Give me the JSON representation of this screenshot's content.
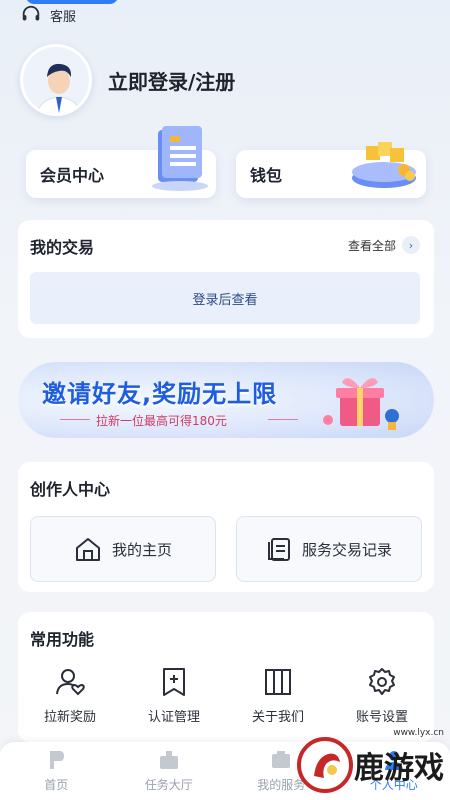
{
  "topbar": {
    "service_label": "客服"
  },
  "profile": {
    "login_text": "立即登录/注册"
  },
  "cards": {
    "member_label": "会员中心",
    "wallet_label": "钱包"
  },
  "trade": {
    "title": "我的交易",
    "view_all": "查看全部",
    "placeholder": "登录后查看"
  },
  "banner": {
    "title": "邀请好友,奖励无上限",
    "subtitle": "拉新一位最高可得180元"
  },
  "creator": {
    "title": "创作人中心",
    "home_label": "我的主页",
    "records_label": "服务交易记录"
  },
  "common": {
    "title": "常用功能",
    "items": [
      {
        "label": "拉新奖励",
        "icon": "user-heart-icon"
      },
      {
        "label": "认证管理",
        "icon": "bookmark-plus-icon"
      },
      {
        "label": "关于我们",
        "icon": "panels-icon"
      },
      {
        "label": "账号设置",
        "icon": "gear-icon"
      }
    ]
  },
  "tabbar": {
    "items": [
      {
        "label": "首页",
        "icon": "home-logo-icon"
      },
      {
        "label": "任务大厅",
        "icon": "task-hall-icon"
      },
      {
        "label": "我的服务",
        "icon": "my-service-icon"
      },
      {
        "label": "个人中心",
        "icon": "profile-icon"
      }
    ]
  },
  "watermark": {
    "text": "鹿游戏",
    "url": "www.lyx.cn"
  },
  "colors": {
    "accent": "#2f7df6",
    "banner_title": "#1f5de0",
    "banner_sub": "#d03a62"
  }
}
